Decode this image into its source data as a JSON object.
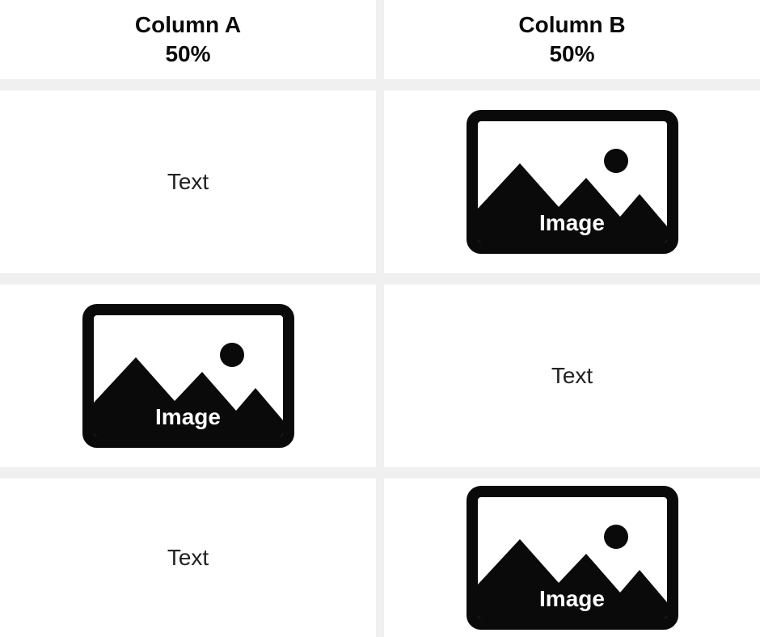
{
  "columns": {
    "a": {
      "title": "Column A",
      "subtitle": "50%"
    },
    "b": {
      "title": "Column B",
      "subtitle": "50%"
    }
  },
  "rows": [
    {
      "left": {
        "type": "text",
        "label": "Text"
      },
      "right": {
        "type": "image",
        "label": "Image"
      }
    },
    {
      "left": {
        "type": "image",
        "label": "Image"
      },
      "right": {
        "type": "text",
        "label": "Text"
      }
    },
    {
      "left": {
        "type": "text",
        "label": "Text"
      },
      "right": {
        "type": "image",
        "label": "Image"
      }
    }
  ]
}
